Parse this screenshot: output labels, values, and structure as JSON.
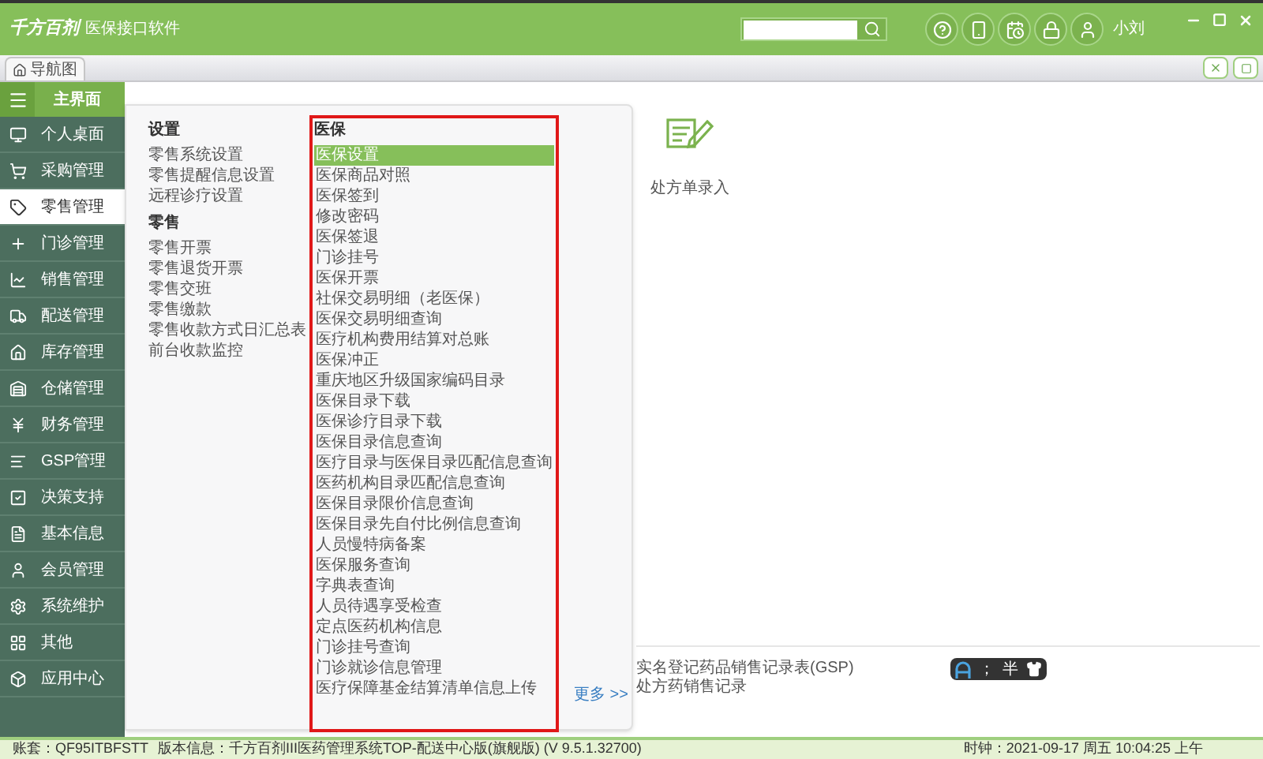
{
  "header": {
    "logo": "千方百剂",
    "app_name": "医保接口软件",
    "user": "小刘"
  },
  "tabs": [
    {
      "label": "导航图",
      "selected": true
    }
  ],
  "sidebar": {
    "title": "主界面",
    "items": [
      {
        "label": "个人桌面",
        "selected": false
      },
      {
        "label": "采购管理",
        "selected": false
      },
      {
        "label": "零售管理",
        "selected": true
      },
      {
        "label": "门诊管理",
        "selected": false
      },
      {
        "label": "销售管理",
        "selected": false
      },
      {
        "label": "配送管理",
        "selected": false
      },
      {
        "label": "库存管理",
        "selected": false
      },
      {
        "label": "仓储管理",
        "selected": false
      },
      {
        "label": "财务管理",
        "selected": false
      },
      {
        "label": "GSP管理",
        "selected": false
      },
      {
        "label": "决策支持",
        "selected": false
      },
      {
        "label": "基本信息",
        "selected": false
      },
      {
        "label": "会员管理",
        "selected": false
      },
      {
        "label": "系统维护",
        "selected": false
      },
      {
        "label": "其他",
        "selected": false
      },
      {
        "label": "应用中心",
        "selected": false
      }
    ]
  },
  "menu_groups": [
    {
      "title": "设置",
      "items": [
        {
          "label": "零售系统设置",
          "selected": false
        },
        {
          "label": "零售提醒信息设置",
          "selected": false
        },
        {
          "label": "远程诊疗设置",
          "selected": false
        }
      ]
    },
    {
      "title": "零售",
      "items": [
        {
          "label": "零售开票",
          "selected": false
        },
        {
          "label": "零售退货开票",
          "selected": false
        },
        {
          "label": "零售交班",
          "selected": false
        },
        {
          "label": "零售缴款",
          "selected": false
        },
        {
          "label": "零售收款方式日汇总表",
          "selected": false
        },
        {
          "label": "前台收款监控",
          "selected": false
        }
      ]
    }
  ],
  "medical_insurance": {
    "title": "医保",
    "items": [
      {
        "label": "医保设置",
        "selected": true
      },
      {
        "label": "医保商品对照",
        "selected": false
      },
      {
        "label": "医保签到",
        "selected": false
      },
      {
        "label": "修改密码",
        "selected": false
      },
      {
        "label": "医保签退",
        "selected": false
      },
      {
        "label": "门诊挂号",
        "selected": false
      },
      {
        "label": "医保开票",
        "selected": false
      },
      {
        "label": "社保交易明细（老医保）",
        "selected": false
      },
      {
        "label": "医保交易明细查询",
        "selected": false
      },
      {
        "label": "医疗机构费用结算对总账",
        "selected": false
      },
      {
        "label": "医保冲正",
        "selected": false
      },
      {
        "label": "重庆地区升级国家编码目录",
        "selected": false
      },
      {
        "label": "医保目录下载",
        "selected": false
      },
      {
        "label": "医保诊疗目录下载",
        "selected": false
      },
      {
        "label": "医保目录信息查询",
        "selected": false
      },
      {
        "label": "医疗目录与医保目录匹配信息查询",
        "selected": false
      },
      {
        "label": "医药机构目录匹配信息查询",
        "selected": false
      },
      {
        "label": "医保目录限价信息查询",
        "selected": false
      },
      {
        "label": "医保目录先自付比例信息查询",
        "selected": false
      },
      {
        "label": "人员慢特病备案",
        "selected": false
      },
      {
        "label": "医保服务查询",
        "selected": false
      },
      {
        "label": "字典表查询",
        "selected": false
      },
      {
        "label": "人员待遇享受检查",
        "selected": false
      },
      {
        "label": "定点医药机构信息",
        "selected": false
      },
      {
        "label": "门诊挂号查询",
        "selected": false
      },
      {
        "label": "门诊就诊信息管理",
        "selected": false
      },
      {
        "label": "医疗保障基金结算清单信息上传",
        "selected": false
      }
    ]
  },
  "more_link": "更多 >>",
  "shortcuts": [
    {
      "label": "处方单录入"
    }
  ],
  "reports": [
    "实名登记药品销售记录表(GSP)",
    "处方药销售记录"
  ],
  "ime": {
    "punctuation": "；",
    "width": "半"
  },
  "status_bar": {
    "account": "账套：QF95ITBFSTT",
    "version": "版本信息：千方百剂III医药管理系统TOP-配送中心版(旗舰版)  (V 9.5.1.32700)",
    "clock": "时钟：2021-09-17 周五 10:04:25 上午"
  }
}
